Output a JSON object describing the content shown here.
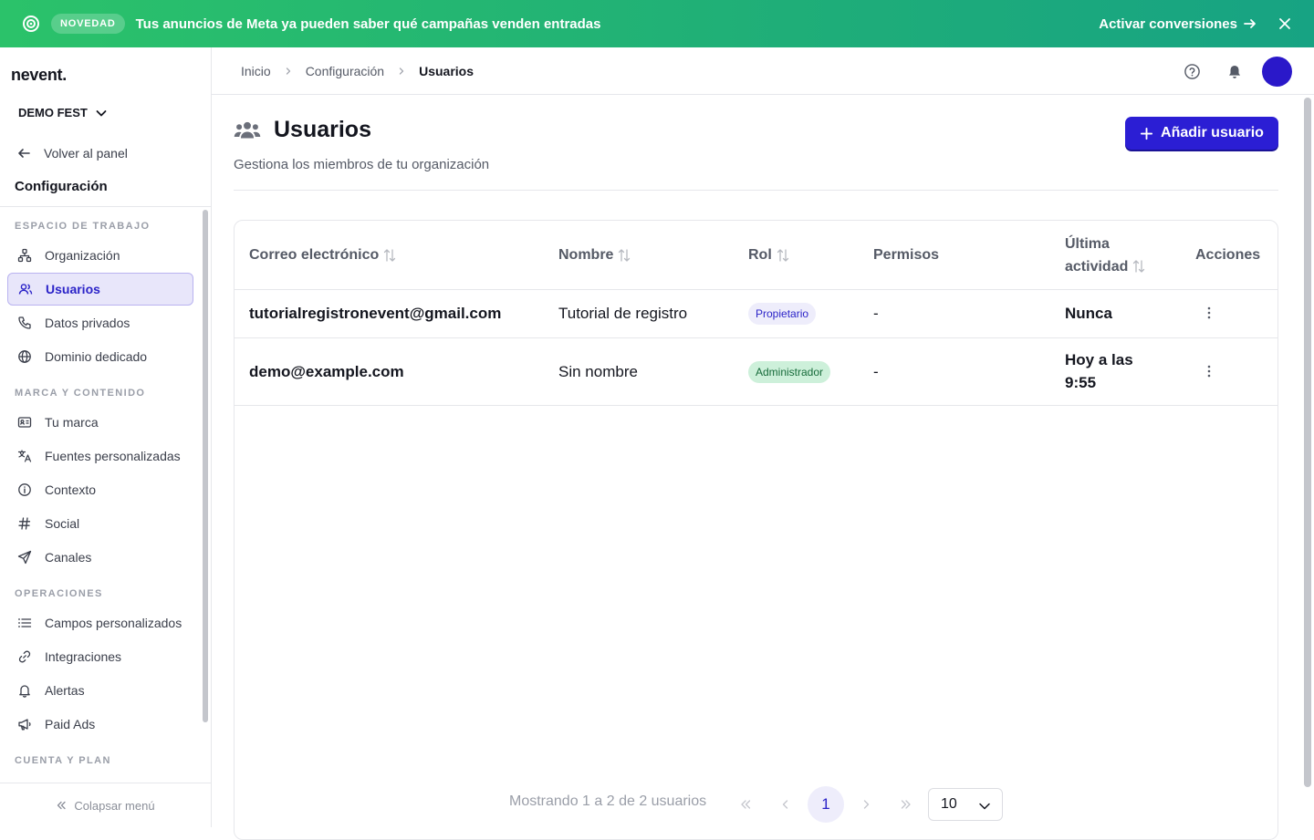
{
  "banner": {
    "badge": "NOVEDAD",
    "message": "Tus anuncios de Meta ya pueden saber qué campañas venden entradas",
    "cta": "Activar conversiones"
  },
  "sidebar": {
    "logo": "nevent.",
    "org": "DEMO FEST",
    "back": "Volver al panel",
    "title": "Configuración",
    "sections": {
      "workspace": "ESPACIO DE TRABAJO",
      "brand": "MARCA Y CONTENIDO",
      "operations": "OPERACIONES",
      "account": "CUENTA Y PLAN"
    },
    "items": {
      "organization": "Organización",
      "users": "Usuarios",
      "private_data": "Datos privados",
      "domain": "Dominio dedicado",
      "brand": "Tu marca",
      "fonts": "Fuentes personalizadas",
      "context": "Contexto",
      "social": "Social",
      "channels": "Canales",
      "custom_fields": "Campos personalizados",
      "integrations": "Integraciones",
      "alerts": "Alertas",
      "paid_ads": "Paid Ads"
    },
    "collapse": "Colapsar menú"
  },
  "breadcrumb": {
    "home": "Inicio",
    "config": "Configuración",
    "current": "Usuarios"
  },
  "page": {
    "title": "Usuarios",
    "subtitle": "Gestiona los miembros de tu organización",
    "add_button": "Añadir usuario"
  },
  "table": {
    "headers": {
      "email": "Correo electrónico",
      "name": "Nombre",
      "role": "Rol",
      "permissions": "Permisos",
      "last_activity_1": "Última",
      "last_activity_2": "actividad",
      "actions": "Acciones"
    },
    "rows": [
      {
        "email": "tutorialregistronevent@gmail.com",
        "name": "Tutorial de registro",
        "role": "Propietario",
        "permissions": "-",
        "last_activity": "Nunca",
        "last_activity_2": ""
      },
      {
        "email": "demo@example.com",
        "name": "Sin nombre",
        "role": "Administrador",
        "permissions": "-",
        "last_activity": "Hoy a las",
        "last_activity_2": "9:55"
      }
    ]
  },
  "pagination": {
    "info": "Mostrando 1 a 2 de 2 usuarios",
    "current_page": "1",
    "page_size": "10"
  },
  "colors": {
    "banner_start": "#2bc26a",
    "banner_end": "#17a383",
    "primary": "#2b1ed4",
    "active_bg": "#e8e6fa",
    "owner_badge_bg": "#eeedfb",
    "admin_badge_bg": "#cdf0da"
  },
  "icons": {
    "banner": "target-icon",
    "close": "close-icon",
    "help": "help-circle-icon",
    "bell": "bell-icon",
    "users": "users-group-icon",
    "plus": "plus-icon",
    "sort": "sort-arrows-icon",
    "more": "kebab-icon"
  }
}
